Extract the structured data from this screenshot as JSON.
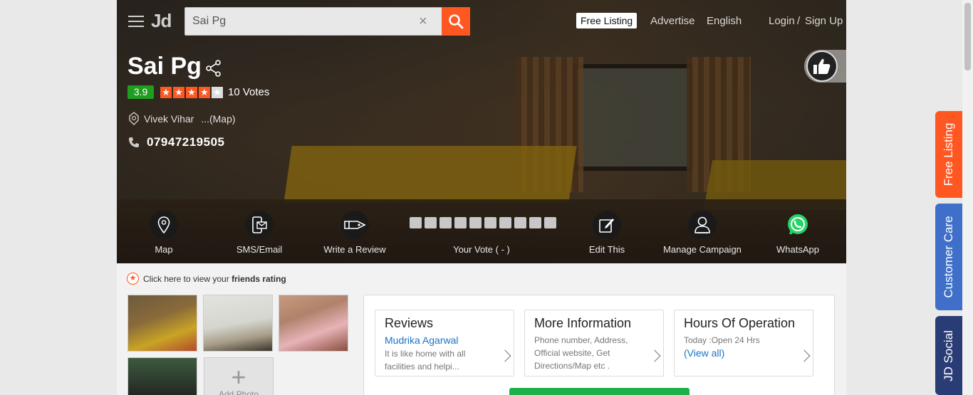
{
  "header": {
    "logo": "Jd",
    "search_value": "Sai Pg",
    "clear": "×",
    "free_listing": "Free Listing",
    "advertise": "Advertise",
    "language": "English",
    "login": "Login",
    "separator": "/",
    "signup": "Sign Up"
  },
  "listing": {
    "name": "Sai Pg",
    "rating": "3.9",
    "stars_filled": 4,
    "stars_total": 5,
    "votes": "10 Votes",
    "address": "Vivek Vihar",
    "map_link": "...(Map)",
    "phone": "07947219505"
  },
  "actions": {
    "map": "Map",
    "sms_email": "SMS/Email",
    "write_review": "Write a Review",
    "your_vote": "Your Vote ( - )",
    "edit": "Edit This",
    "manage_campaign": "Manage Campaign",
    "whatsapp": "WhatsApp"
  },
  "friends": {
    "prefix": "Click here to view your",
    "bold": "friends rating"
  },
  "photos": {
    "add_label": "Add Photo"
  },
  "info_cards": {
    "reviews": {
      "title": "Reviews",
      "author": "Mudrika Agarwal",
      "text": "It is like home with all facilities and helpi..."
    },
    "more": {
      "title": "More Information",
      "text": "Phone number, Address, Official website, Get Directions/Map etc ."
    },
    "hours": {
      "title": "Hours Of Operation",
      "text": "Today :Open 24 Hrs",
      "link": "(View all)"
    }
  },
  "side_tabs": {
    "free_listing": "Free Listing",
    "customer_care": "Customer Care",
    "jd_social": "JD Social"
  },
  "colors": {
    "accent": "#ff5722",
    "rating_green": "#1f9d1f",
    "customer_care_blue": "#3f6fc9",
    "jd_social_navy": "#2a3c75",
    "link_blue": "#1a73c9"
  }
}
